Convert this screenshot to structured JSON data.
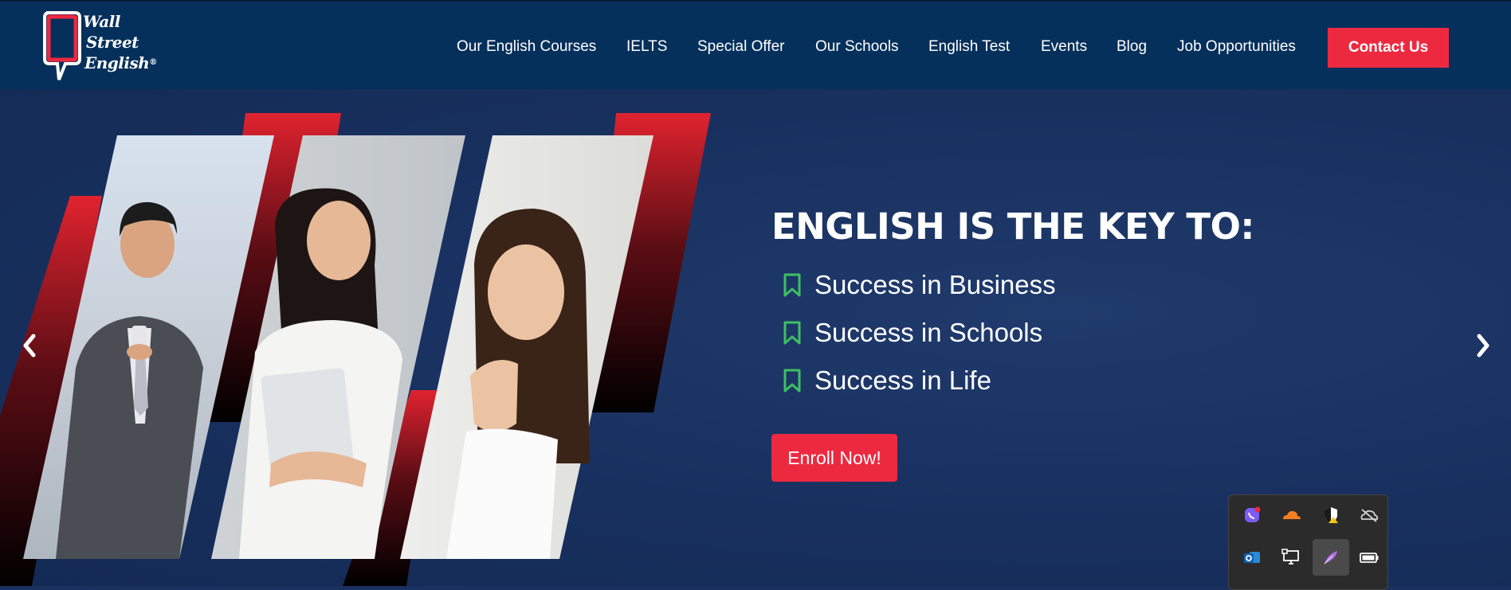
{
  "header": {
    "logo": {
      "line1": "Wall",
      "line2": "Street",
      "line3": "English",
      "mark": "®"
    },
    "nav": [
      {
        "label": "Our English Courses"
      },
      {
        "label": "IELTS"
      },
      {
        "label": "Special Offer"
      },
      {
        "label": "Our Schools"
      },
      {
        "label": "English Test"
      },
      {
        "label": "Events"
      },
      {
        "label": "Blog"
      },
      {
        "label": "Job Opportunities"
      }
    ],
    "contact_label": "Contact Us"
  },
  "hero": {
    "headline": "ENGLISH IS THE KEY TO:",
    "bullets": [
      {
        "text": "Success in Business"
      },
      {
        "text": "Success in Schools"
      },
      {
        "text": "Success in Life"
      }
    ],
    "enroll_label": "Enroll Now!",
    "prev_icon": "chevron-left-icon",
    "next_icon": "chevron-right-icon"
  },
  "tray": {
    "icons": [
      {
        "name": "viber-icon"
      },
      {
        "name": "cloudflare-icon"
      },
      {
        "name": "security-shield-icon"
      },
      {
        "name": "onedrive-offline-icon"
      },
      {
        "name": "outlook-icon"
      },
      {
        "name": "display-icon"
      },
      {
        "name": "feather-icon",
        "active": true
      },
      {
        "name": "battery-icon"
      }
    ]
  },
  "colors": {
    "header_bg": "#06305c",
    "hero_bg": "#1a3160",
    "accent_red": "#ed2940",
    "bookmark_green": "#3dbf62"
  }
}
